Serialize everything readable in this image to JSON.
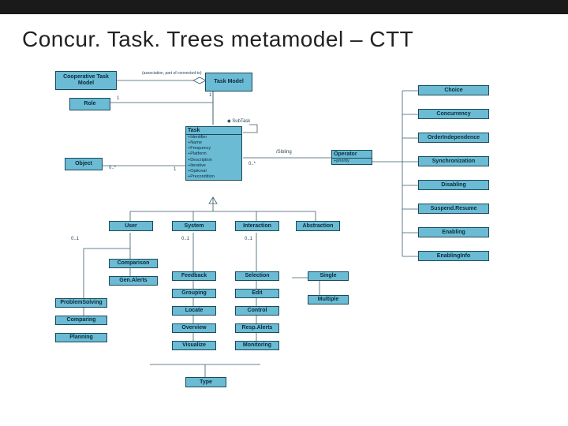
{
  "title": "Concur. Task. Trees metamodel – CTT",
  "boxes": {
    "coopTaskModel": "Cooperative Task Model",
    "taskModel": "Task Model",
    "role": "Role",
    "object": "Object",
    "subTask": "SubTask",
    "task": "Task",
    "taskAttrs": [
      "+Identifier",
      "+Name",
      "+Frequency",
      "+Platform",
      "+Description",
      "+Iterative",
      "+Optional",
      "+Precondition"
    ],
    "user": "User",
    "system": "System",
    "interaction": "Interaction",
    "abstraction": "Abstraction",
    "operator": "Operator",
    "operatorAttr": "+priority",
    "choice": "Choice",
    "concurrency": "Concurrency",
    "orderIndep": "OrderIndependence",
    "synchronization": "Synchronization",
    "disabling": "Disabling",
    "suspendResume": "Suspend.Resume",
    "enabling": "Enabling",
    "enablingInfo": "EnablingInfo",
    "comparison": "Comparison",
    "genAlerts": "Gen.Alerts",
    "problemSolving": "ProblemSolving",
    "comparing": "Comparing",
    "planning": "Planning",
    "feedback": "Feedback",
    "grouping": "Grouping",
    "locate": "Locate",
    "overview": "Overview",
    "visualize": "Visualize",
    "selection": "Selection",
    "edit": "Edit",
    "control": "Control",
    "respAlerts": "Resp.Alerts",
    "monitoring": "Monitoring",
    "single": "Single",
    "multiple": "Multiple",
    "type": "Type"
  },
  "labels": {
    "one": "1",
    "zeroStar": "0..*",
    "zeroOne": "0..1",
    "sibling": "/Sibling",
    "assoc": "(association, part of connected-to)"
  }
}
